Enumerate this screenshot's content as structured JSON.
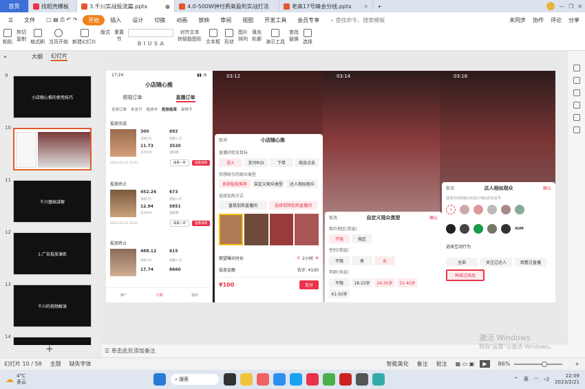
{
  "tabs": {
    "home": "首页",
    "t1": "找稻壳模板",
    "t2": "3.千川实战投流篇.pptx",
    "t3": "4.0-500W钟付费高盈利实战打法",
    "t4": "老高17号峰会分线.pptx",
    "add": "+"
  },
  "menu": {
    "file": "文件",
    "items": [
      "开始",
      "插入",
      "设计",
      "切换",
      "动画",
      "放映",
      "审阅",
      "视图",
      "开发工具",
      "会员专享"
    ],
    "search": "查找命令、搜索模板",
    "sync": "未同步",
    "collab": "协作",
    "comment": "评论",
    "share": "分享"
  },
  "ribbon": {
    "paste": "粘贴",
    "cut": "剪切",
    "copy": "复制",
    "format": "格式刷",
    "play": "当页开始",
    "new_slide": "新建幻灯片",
    "layout": "版式",
    "section": "节",
    "reset": "重置",
    "align": "对齐文本",
    "convert": "转智能图形",
    "textbox": "文本框",
    "shape": "形状",
    "arrange": "排列",
    "picture": "图片",
    "fill": "填充",
    "outline": "轮廓",
    "present": "演示工具",
    "find": "查找",
    "replace": "替换",
    "select": "选择"
  },
  "leftpane": {
    "outline": "大纲",
    "slides": "幻灯片",
    "rows": [
      {
        "n": "9",
        "title": "小店随心推的使用技巧"
      },
      {
        "n": "10",
        "title": ""
      },
      {
        "n": "11",
        "title": "千川基础讲解"
      },
      {
        "n": "12",
        "title": "1.广告投放演练"
      },
      {
        "n": "13",
        "title": "千川的视频解读"
      },
      {
        "n": "14",
        "title": ""
      }
    ]
  },
  "phone": {
    "time": "17:24",
    "title": "小店随心推",
    "tab_a": "短视订单",
    "tab_b": "直播订单",
    "filters": [
      "全部订单",
      "未支付",
      "投放中",
      "投放结束",
      "审核不"
    ],
    "status1": "投放完成",
    "status2": "投放终止",
    "status3": "投放终止",
    "orders": [
      {
        "a": "300",
        "al": "消耗(元)",
        "b": "692",
        "bl": "观看人次",
        "c": "11.73",
        "cl": "支付ROI",
        "d": "3520",
        "dl": "涨粉量",
        "date": "2023-01-22 12:23"
      },
      {
        "a": "452.26",
        "al": "消耗(元)",
        "b": "673",
        "bl": "观看人次",
        "c": "12.94",
        "cl": "支付ROI",
        "d": "5851",
        "dl": "涨粉量",
        "date": "2023-01-22 13:31"
      },
      {
        "a": "488.12",
        "al": "消耗(元)",
        "b": "615",
        "bl": "观看人次",
        "c": "17.74",
        "cl": "支付ROI",
        "d": "8660",
        "dl": "涨粉量",
        "date": ""
      }
    ],
    "again": "再来一单",
    "detail": "查看详情",
    "nav": [
      "推广",
      "订单",
      "我的"
    ]
  },
  "slide_times": [
    "03:12",
    "03:14",
    "03:16"
  ],
  "panel2": {
    "cancel": "取消",
    "title": "小店随心推",
    "opt_target": "直播间优化目标",
    "t1": "进入",
    "t2": "支付ROI",
    "t3": "下单",
    "t4": "商品点击",
    "audience": "你想吸引的观众类型",
    "a1": "系统智能推荐",
    "a2": "自定义观众类型",
    "a3": "达人相似观众",
    "method": "选择加热方式",
    "m1": "直接加热直播间",
    "m2": "选择视频加热直播间",
    "exp": "期望曝光时长",
    "hours": "2小时",
    "budget": "投放金额",
    "total": "合计: ¥100",
    "price": "¥100",
    "pay": "支付"
  },
  "panel3": {
    "cancel": "取消",
    "title": "自定义观众类型",
    "confirm": "确认",
    "region": "观众地区(单选)",
    "r1": "不限",
    "r2": "按区",
    "gender": "性别(单选)",
    "g1": "不限",
    "g2": "男",
    "g3": "女",
    "age": "年龄(多选)",
    "ag1": "不限",
    "ag2": "18-23岁",
    "ag3": "24-30岁",
    "ag4": "31-40岁",
    "ag5": "41-50岁"
  },
  "panel4": {
    "cancel": "取消",
    "title": "达人相似观众",
    "confirm": "确认",
    "hint": "选择与你想吸引的观众相似的抖音号",
    "behavior": "选择互动行为",
    "b1": "全部",
    "b2": "关注过达人",
    "b3": "观看过直播",
    "b4": "种草过商品",
    "aum": "AUM"
  },
  "notes": "单击此处添加备注",
  "status": {
    "slide": "幻灯片 10 / 58",
    "theme": "主题",
    "font": "缺失字体",
    "smart": "智能美化",
    "notes": "备注",
    "comment": "批注",
    "zoom": "86%"
  },
  "watermark": {
    "l1": "激活 Windows",
    "l2": "转到\"设置\"以激活 Windows。"
  },
  "taskbar": {
    "temp": "4°C",
    "weather": "多云",
    "search": "搜索",
    "lang": "英",
    "time": "22:09",
    "date": "2023/2/21"
  }
}
